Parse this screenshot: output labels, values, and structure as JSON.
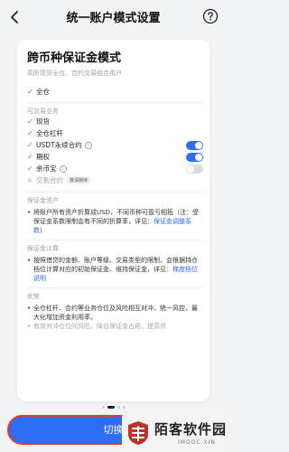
{
  "header": {
    "title": "统一账户模式设置",
    "back_icon": "chevron-left-icon",
    "help_icon": "help-circle-icon"
  },
  "card": {
    "title": "跨币种保证金模式",
    "subtitle": "高阶现货全仓、合约交易组合用户",
    "margin_modes": [
      {
        "label": "全仓"
      }
    ],
    "tradable_label": "可交易业务",
    "businesses": [
      {
        "label": "现货",
        "toggle": null,
        "info": false
      },
      {
        "label": "全仓杠杆",
        "toggle": null,
        "info": false
      },
      {
        "label": "USDT永续合约",
        "toggle": true,
        "info": true
      },
      {
        "label": "期权",
        "toggle": true,
        "info": false
      },
      {
        "label": "余币宝",
        "toggle": false,
        "info": true
      }
    ],
    "cross_contract": {
      "label": "交割合约",
      "tag": "敬请期待"
    },
    "assets_label": "保证金资产",
    "assets_desc": "将账户所有资产折算成USD，不同币种可盈亏相抵（注：受保证金系数限制会有不同的折算率，详见：",
    "assets_link": "保证金调整系数",
    "assets_tail": "）",
    "calc_label": "保证金计算",
    "calc_desc": "按照借贷的金额、账户等级、交易类型的限制，会根据持仓档位计算对应的初始保证金、维持保证金，详见：",
    "calc_link": "梯度档位说明",
    "adv_label": "优势",
    "adv_desc": "全仓杠杆、合约等业务仓位及风险相互对冲，统一风控，最大化增加资金利用率。",
    "adv_cut": "有效对冲仓位间风险，降低保证金占用，提高资"
  },
  "pager": {
    "total": 4,
    "active": 1
  },
  "action": {
    "switch_label": "切换"
  },
  "watermark": {
    "text": "陌客软件园",
    "sub": "IMOOC.XIN"
  },
  "colors": {
    "accent": "#2e6df6",
    "check": "#3d9c5f",
    "highlight": "#e23b2e"
  }
}
